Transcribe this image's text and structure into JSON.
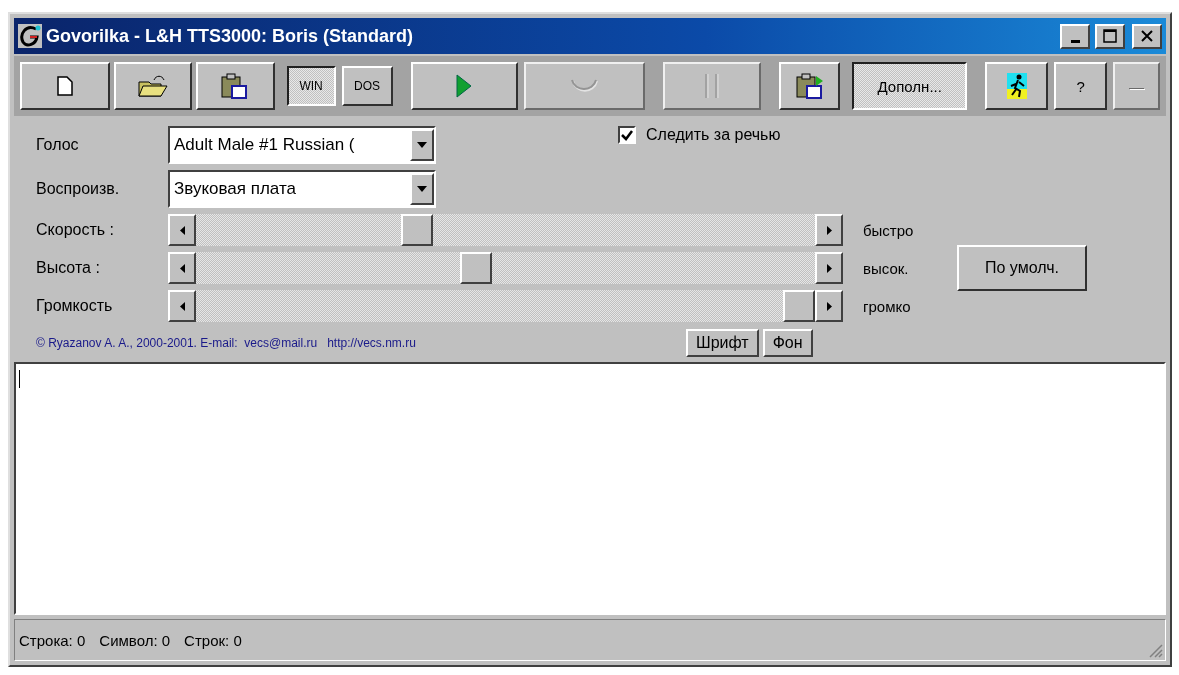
{
  "window": {
    "title": "Govorilka - L&H TTS3000: Boris (Standard)"
  },
  "toolbar": [
    {
      "kind": "new",
      "disabled": false,
      "pressed": false
    },
    {
      "kind": "open",
      "disabled": false,
      "pressed": false
    },
    {
      "kind": "paste",
      "disabled": false,
      "pressed": false
    },
    {
      "kind": "text",
      "label": "WIN",
      "disabled": false,
      "pressed": true
    },
    {
      "kind": "text",
      "label": "DOS",
      "disabled": false,
      "pressed": false
    },
    {
      "kind": "play",
      "disabled": false,
      "pressed": false
    },
    {
      "kind": "stop",
      "disabled": true,
      "pressed": false
    },
    {
      "kind": "pause",
      "disabled": true,
      "pressed": false
    },
    {
      "kind": "paste-play",
      "disabled": false,
      "pressed": false
    },
    {
      "kind": "text",
      "label": "Дополн...",
      "disabled": false,
      "pressed": true
    },
    {
      "kind": "runner",
      "disabled": false,
      "pressed": false
    },
    {
      "kind": "text",
      "label": "?",
      "disabled": false,
      "pressed": false
    },
    {
      "kind": "text",
      "label": "—",
      "disabled": true,
      "pressed": false
    }
  ],
  "voice": {
    "label": "Голос",
    "value": "Adult Male #1 Russian ("
  },
  "track_speech": {
    "label": "Следить за речью",
    "checked": true
  },
  "output": {
    "label": "Воспроизв.",
    "value": "Звуковая плата"
  },
  "sliders": [
    {
      "label": "Скорость :",
      "level": 0.35,
      "end_label": "быстро"
    },
    {
      "label": "Высота :",
      "level": 0.45,
      "end_label": "высок."
    },
    {
      "label": "Громкость",
      "level": 1.0,
      "end_label": "громко"
    }
  ],
  "default_button": "По умолч.",
  "copyright": "© Ryazanov A. A., 2000-2001. E-mail:  vecs@mail.ru   http://vecs.nm.ru",
  "font_button": "Шрифт",
  "background_button": "Фон",
  "status_bar": [
    "Строка: 0",
    "Символ: 0",
    "Строк: 0"
  ]
}
